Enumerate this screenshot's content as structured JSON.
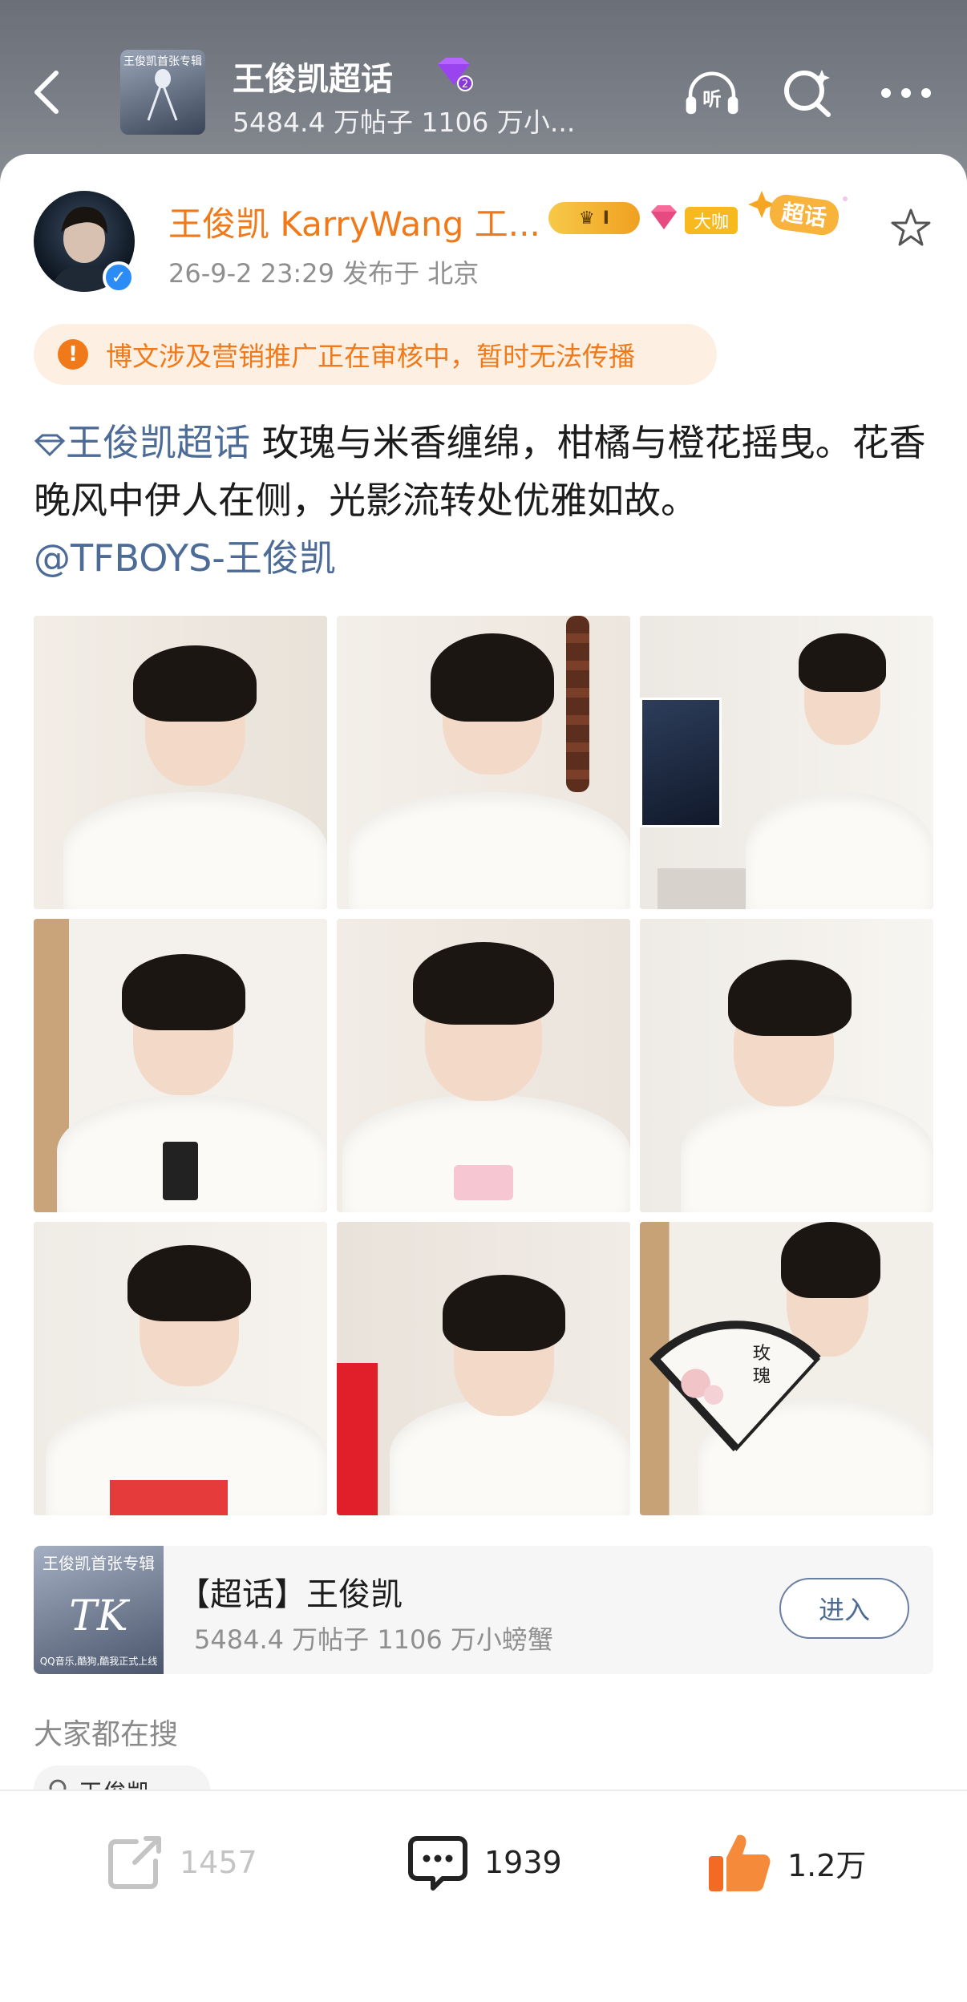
{
  "header": {
    "title": "王俊凯超话",
    "subtitle": "5484.4 万帖子 1106 万小...",
    "thumb_text": "王俊凯首张专辑",
    "colors": {
      "bg": "#7c8088",
      "text": "#ffffff"
    }
  },
  "post": {
    "author": "王俊凯 KarryWang 工...",
    "crown_badge_text": "I",
    "dk_badge": "大咖",
    "chaohua_badge": "超话",
    "meta": "26-9-2 23:29   发布于 北京",
    "warning": "博文涉及营销推广正在审核中，暂时无法传播",
    "topic_link": "王俊凯超话",
    "body": " 玫瑰与米香缠绵，柑橘与橙花摇曳。花香晚风中伊人在侧，光影流转处优雅如故。",
    "mention": "@TFBOYS-王俊凯",
    "fan_text_1": "玫",
    "fan_text_2": "瑰"
  },
  "supertopic": {
    "name": "【超话】王俊凯",
    "stats": "5484.4 万帖子 1106 万小螃蟹",
    "enter_label": "进入",
    "thumb_text": "王俊凯首张专辑",
    "thumb_big": "TK",
    "thumb_foot": "QQ音乐,酷狗,酷我正式上线"
  },
  "search": {
    "title": "大家都在搜",
    "chip_label": "王俊凯"
  },
  "actions": {
    "share_count": "1457",
    "comment_count": "1939",
    "like_count": "1.2万"
  },
  "colors": {
    "accent_orange": "#f07a1a",
    "link_blue": "#4d6b97",
    "like_orange": "#f26a24"
  }
}
